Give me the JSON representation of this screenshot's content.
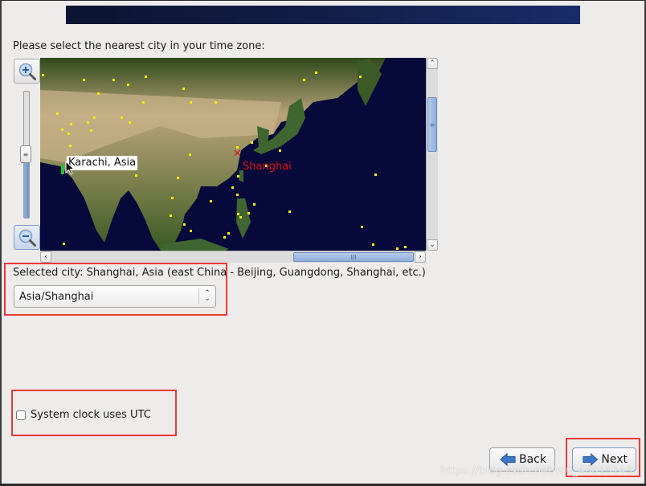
{
  "page": {
    "prompt": "Please select the nearest city in your time zone:",
    "selected_city_text": "Selected city: Shanghai, Asia (east China - Beijing, Guangdong, Shanghai, etc.)"
  },
  "map": {
    "selected_city_label": "Shanghai",
    "selected_marker": "x",
    "hover_label": "Karachi, Asia",
    "zoom_level": 0.55,
    "colors": {
      "selected": "#e01010",
      "city_dot": "#f2ee00",
      "ocean": "#06093a"
    }
  },
  "timezone_select": {
    "value": "Asia/Shanghai"
  },
  "utc_checkbox": {
    "label": "System clock uses UTC",
    "checked": false
  },
  "buttons": {
    "back": "Back",
    "next": "Next"
  },
  "watermark": "https://blog.csdn.net/m0_46015143",
  "accent_color": "#e83a3a"
}
